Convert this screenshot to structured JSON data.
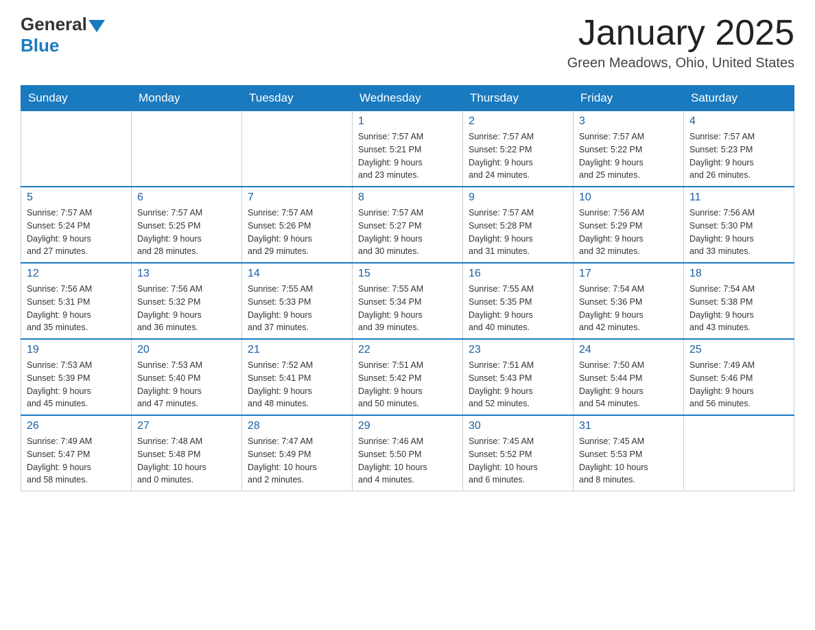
{
  "header": {
    "logo_general": "General",
    "logo_blue": "Blue",
    "title": "January 2025",
    "subtitle": "Green Meadows, Ohio, United States"
  },
  "days_of_week": [
    "Sunday",
    "Monday",
    "Tuesday",
    "Wednesday",
    "Thursday",
    "Friday",
    "Saturday"
  ],
  "weeks": [
    [
      {
        "day": "",
        "info": ""
      },
      {
        "day": "",
        "info": ""
      },
      {
        "day": "",
        "info": ""
      },
      {
        "day": "1",
        "info": "Sunrise: 7:57 AM\nSunset: 5:21 PM\nDaylight: 9 hours\nand 23 minutes."
      },
      {
        "day": "2",
        "info": "Sunrise: 7:57 AM\nSunset: 5:22 PM\nDaylight: 9 hours\nand 24 minutes."
      },
      {
        "day": "3",
        "info": "Sunrise: 7:57 AM\nSunset: 5:22 PM\nDaylight: 9 hours\nand 25 minutes."
      },
      {
        "day": "4",
        "info": "Sunrise: 7:57 AM\nSunset: 5:23 PM\nDaylight: 9 hours\nand 26 minutes."
      }
    ],
    [
      {
        "day": "5",
        "info": "Sunrise: 7:57 AM\nSunset: 5:24 PM\nDaylight: 9 hours\nand 27 minutes."
      },
      {
        "day": "6",
        "info": "Sunrise: 7:57 AM\nSunset: 5:25 PM\nDaylight: 9 hours\nand 28 minutes."
      },
      {
        "day": "7",
        "info": "Sunrise: 7:57 AM\nSunset: 5:26 PM\nDaylight: 9 hours\nand 29 minutes."
      },
      {
        "day": "8",
        "info": "Sunrise: 7:57 AM\nSunset: 5:27 PM\nDaylight: 9 hours\nand 30 minutes."
      },
      {
        "day": "9",
        "info": "Sunrise: 7:57 AM\nSunset: 5:28 PM\nDaylight: 9 hours\nand 31 minutes."
      },
      {
        "day": "10",
        "info": "Sunrise: 7:56 AM\nSunset: 5:29 PM\nDaylight: 9 hours\nand 32 minutes."
      },
      {
        "day": "11",
        "info": "Sunrise: 7:56 AM\nSunset: 5:30 PM\nDaylight: 9 hours\nand 33 minutes."
      }
    ],
    [
      {
        "day": "12",
        "info": "Sunrise: 7:56 AM\nSunset: 5:31 PM\nDaylight: 9 hours\nand 35 minutes."
      },
      {
        "day": "13",
        "info": "Sunrise: 7:56 AM\nSunset: 5:32 PM\nDaylight: 9 hours\nand 36 minutes."
      },
      {
        "day": "14",
        "info": "Sunrise: 7:55 AM\nSunset: 5:33 PM\nDaylight: 9 hours\nand 37 minutes."
      },
      {
        "day": "15",
        "info": "Sunrise: 7:55 AM\nSunset: 5:34 PM\nDaylight: 9 hours\nand 39 minutes."
      },
      {
        "day": "16",
        "info": "Sunrise: 7:55 AM\nSunset: 5:35 PM\nDaylight: 9 hours\nand 40 minutes."
      },
      {
        "day": "17",
        "info": "Sunrise: 7:54 AM\nSunset: 5:36 PM\nDaylight: 9 hours\nand 42 minutes."
      },
      {
        "day": "18",
        "info": "Sunrise: 7:54 AM\nSunset: 5:38 PM\nDaylight: 9 hours\nand 43 minutes."
      }
    ],
    [
      {
        "day": "19",
        "info": "Sunrise: 7:53 AM\nSunset: 5:39 PM\nDaylight: 9 hours\nand 45 minutes."
      },
      {
        "day": "20",
        "info": "Sunrise: 7:53 AM\nSunset: 5:40 PM\nDaylight: 9 hours\nand 47 minutes."
      },
      {
        "day": "21",
        "info": "Sunrise: 7:52 AM\nSunset: 5:41 PM\nDaylight: 9 hours\nand 48 minutes."
      },
      {
        "day": "22",
        "info": "Sunrise: 7:51 AM\nSunset: 5:42 PM\nDaylight: 9 hours\nand 50 minutes."
      },
      {
        "day": "23",
        "info": "Sunrise: 7:51 AM\nSunset: 5:43 PM\nDaylight: 9 hours\nand 52 minutes."
      },
      {
        "day": "24",
        "info": "Sunrise: 7:50 AM\nSunset: 5:44 PM\nDaylight: 9 hours\nand 54 minutes."
      },
      {
        "day": "25",
        "info": "Sunrise: 7:49 AM\nSunset: 5:46 PM\nDaylight: 9 hours\nand 56 minutes."
      }
    ],
    [
      {
        "day": "26",
        "info": "Sunrise: 7:49 AM\nSunset: 5:47 PM\nDaylight: 9 hours\nand 58 minutes."
      },
      {
        "day": "27",
        "info": "Sunrise: 7:48 AM\nSunset: 5:48 PM\nDaylight: 10 hours\nand 0 minutes."
      },
      {
        "day": "28",
        "info": "Sunrise: 7:47 AM\nSunset: 5:49 PM\nDaylight: 10 hours\nand 2 minutes."
      },
      {
        "day": "29",
        "info": "Sunrise: 7:46 AM\nSunset: 5:50 PM\nDaylight: 10 hours\nand 4 minutes."
      },
      {
        "day": "30",
        "info": "Sunrise: 7:45 AM\nSunset: 5:52 PM\nDaylight: 10 hours\nand 6 minutes."
      },
      {
        "day": "31",
        "info": "Sunrise: 7:45 AM\nSunset: 5:53 PM\nDaylight: 10 hours\nand 8 minutes."
      },
      {
        "day": "",
        "info": ""
      }
    ]
  ]
}
